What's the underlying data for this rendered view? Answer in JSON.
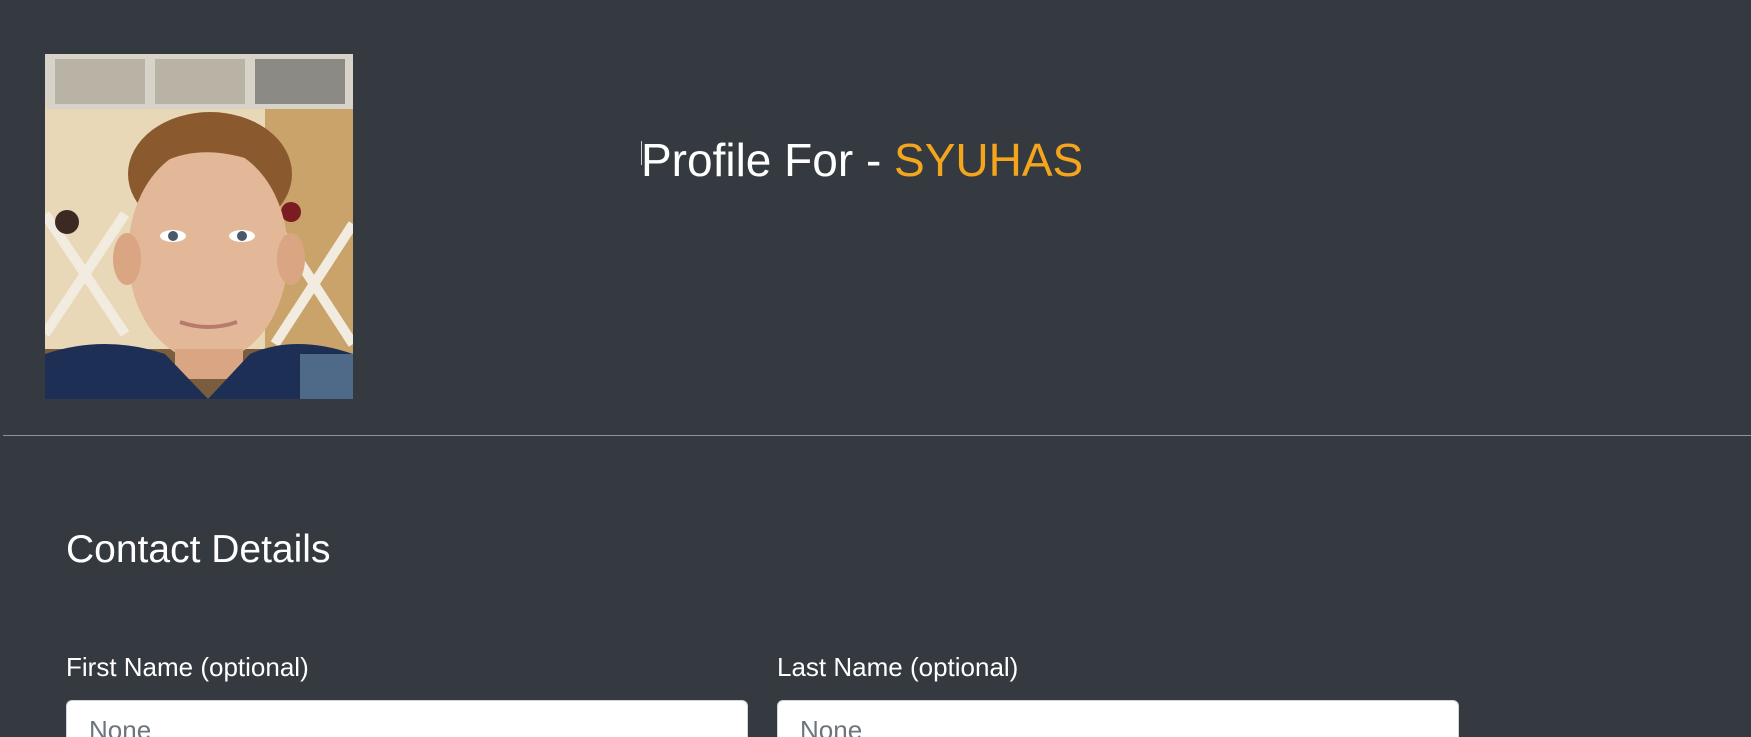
{
  "profile": {
    "title_prefix": "Profile For - ",
    "username": "SYUHAS",
    "username_color": "#f4a51c"
  },
  "contact": {
    "section_title": "Contact Details",
    "first_name": {
      "label": "First Name (optional)",
      "value": "",
      "placeholder": "None"
    },
    "last_name": {
      "label": "Last Name (optional)",
      "value": "",
      "placeholder": "None"
    }
  },
  "colors": {
    "background": "#343a40",
    "accent": "#f4a51c"
  }
}
